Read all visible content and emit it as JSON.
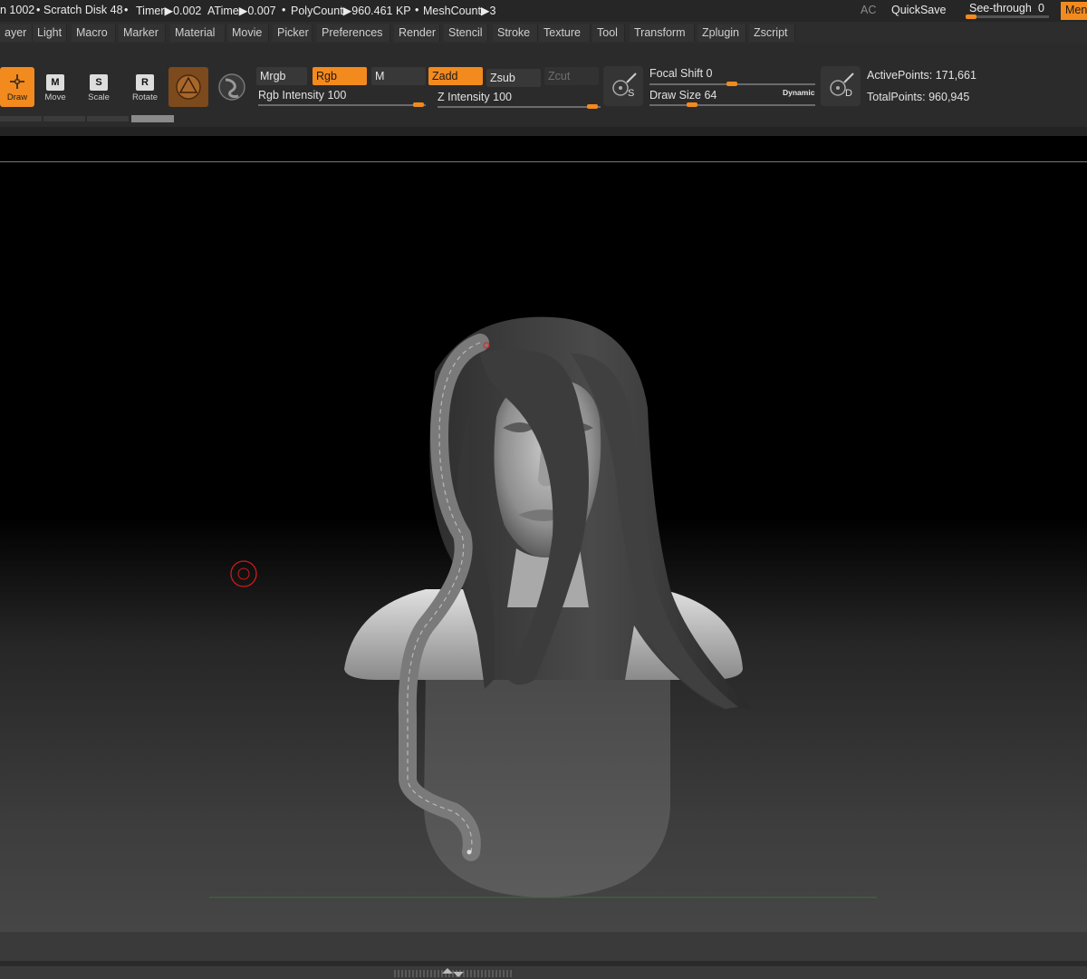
{
  "status_bar": {
    "mem_tail": "n 1002",
    "scratch_disk": "Scratch Disk 48",
    "timer": "Timer▶0.002",
    "atime": "ATime▶0.007",
    "polycount": "PolyCount▶960.461 KP",
    "meshcount": "MeshCount▶3",
    "ac_label": "AC",
    "quicksave_label": "QuickSave",
    "seethrough_label": "See-through",
    "seethrough_value": "0",
    "menus_label": "Menus"
  },
  "menu_bar": [
    "ayer",
    "Light",
    "Macro",
    "Marker",
    "Material",
    "Movie",
    "Picker",
    "Preferences",
    "Render",
    "Stencil",
    "Stroke",
    "Texture",
    "Tool",
    "Transform",
    "Zplugin",
    "Zscript"
  ],
  "shelf": {
    "tools": {
      "draw": "Draw",
      "move": "Move",
      "scale": "Scale",
      "rotate": "Rotate"
    },
    "tool_keys": {
      "move": "M",
      "scale": "S",
      "rotate": "R"
    },
    "mrgb": "Mrgb",
    "rgb": "Rgb",
    "m": "M",
    "zadd": "Zadd",
    "zsub": "Zsub",
    "zcut": "Zcut",
    "rgb_intensity_label": "Rgb Intensity",
    "rgb_intensity_value": "100",
    "z_intensity_label": "Z Intensity",
    "z_intensity_value": "100",
    "focal_shift_label": "Focal Shift",
    "focal_shift_value": "0",
    "draw_size_label": "Draw Size",
    "draw_size_value": "64",
    "dynamic_label": "Dynamic",
    "lightbox_s_key": "S",
    "lightbox_d_key": "D",
    "active_points": "ActivePoints: 171,661",
    "total_points": "TotalPoints: 960,945"
  },
  "colors": {
    "accent": "#f28a1e",
    "panel": "#2b2b2b",
    "text": "#d6d6d6",
    "cursor_ring": "#d11a1a",
    "floor_line": "#3f6e3a"
  },
  "icons": [
    "draw-icon",
    "move-icon",
    "scale-icon",
    "rotate-icon",
    "material-sphere-icon",
    "alpha-icon",
    "lightbox-s-icon",
    "lightbox-d-icon",
    "brush-cursor-icon"
  ]
}
